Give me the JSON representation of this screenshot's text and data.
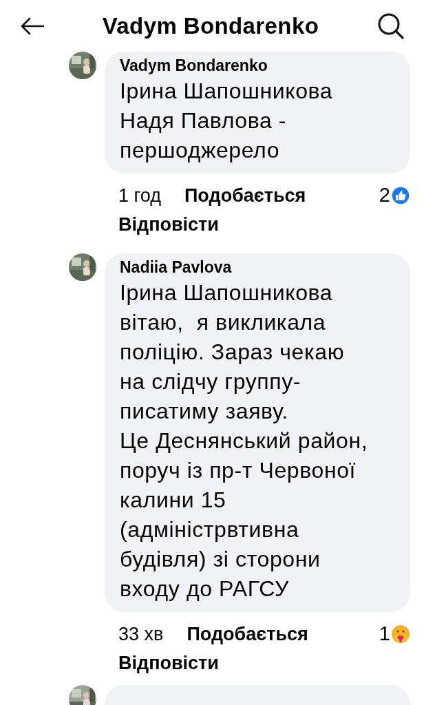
{
  "header": {
    "title": "Vadym Bondarenko"
  },
  "comments": [
    {
      "kind": "comment",
      "author": "Vadym Bondarenko",
      "text": "Ірина Шапошникова\nНадя Павлова -\nпершоджерело",
      "time": "1 год",
      "like": "Подобається",
      "reply": "Відповісти",
      "reaction": {
        "kind": "like",
        "count": "2"
      }
    },
    {
      "kind": "comment",
      "author": "Nadiia Pavlova",
      "text": "Ірина Шапошникова\nвітаю,  я викликала\nполіцію. Зараз чекаю\nна слідчу группу-\nписатиму заяву.\nЦе Деснянський район,\nпоруч із пр-т Червоної\nкалини 15\n(адміністрвтивна\nбудівля) зі сторони\nвходу до РАГСУ",
      "time": "33 хв",
      "like": "Подобається",
      "reply": "Відповісти",
      "reaction": {
        "kind": "care",
        "count": "1"
      }
    },
    {
      "kind": "cut_off"
    }
  ]
}
